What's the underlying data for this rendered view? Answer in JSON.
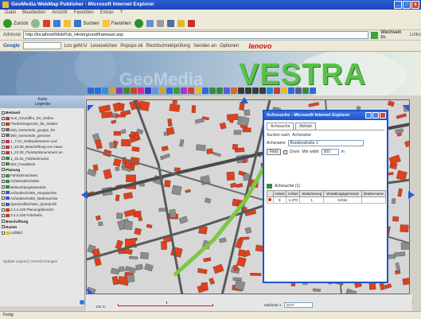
{
  "window": {
    "title": "GeoMedia WebMap Publisher - Microsoft Internet Explorer"
  },
  "menu": [
    "Datei",
    "Bearbeiten",
    "Ansicht",
    "Favoriten",
    "Extras",
    "?"
  ],
  "toolbar": {
    "back": "Zurück",
    "search": "Suchen",
    "favorites": "Favoriten"
  },
  "address": {
    "label": "Adresse",
    "url": "http://localhost/WebPub_Hintergrund/frameset.asp",
    "go": "Wechseln zu",
    "links": "Links"
  },
  "google": {
    "label": "Google",
    "items": [
      "Los geht's!",
      "Lesezeichen",
      "Popups ok",
      "Rechtschreibprüfung",
      "Senden an",
      "Optionen"
    ],
    "brand": "lenovo"
  },
  "banner": {
    "left": "GeoMedia",
    "right": "VESTRA"
  },
  "legend": {
    "header_line1": "Karte",
    "header_line2": "Legende",
    "groups": [
      {
        "label": "Bestand",
        "items": [
          "ALK_Grundflur_für_Online",
          "Flurstücksgrenze_für_Gebiet",
          "200_Gemeinde_gruppe_für",
          "300_Gemeinde_grenzen",
          "1_7:22_Gebäudenamen und",
          "1_10:30_Beschriftung von Haus",
          "1_21:30_Flurstücksnummern an",
          "1_22:31_Fahrbahnrand",
          "302_Fundstück"
        ]
      },
      {
        "label": "Planung",
        "items": [
          "Fahrbahnachsen",
          "Achsenabschnitte",
          "Beleuchtungsstandort",
          "Achsabschnitte_Hauptachse",
          "Achsabschnitte_Nebenachse",
          "Querprofilachsen_Querprofil",
          "3.2.4.100 Planungsbereich",
          "3.2.4.100 Fahrbahn"
        ]
      },
      {
        "label": "Beschriftung",
        "items": []
      },
      {
        "label": "Raster",
        "items": [
          "Luftbild"
        ]
      }
    ],
    "footer": "Update Legend | Overall Changes"
  },
  "popup": {
    "title": "Achssuche - Microsoft Internet Explorer",
    "tabs": [
      "Achssuche",
      "Achsnr"
    ],
    "search_for_label": "Suchen nach",
    "search_for_value": "Achsname",
    "axis_label": "Achsname",
    "axis_value": "Bundesstraße 1",
    "find_button": "Find",
    "zoom_label": "Zoom",
    "min_width_label": "Min width",
    "min_width_value": "500",
    "min_width_unit": "m",
    "results_title": "Achssuche (1)",
    "columns": [
      "Anlass",
      "Achsnr",
      "Stationierung",
      "Verwaltungsgemeinde",
      "Straßenname"
    ],
    "rows": [
      {
        "anlass": "8",
        "achsnr": "1,370",
        "station": "1",
        "verwaltung": "Achse",
        "name": ""
      }
    ]
  },
  "scale": {
    "label": "100 m",
    "mstab_label": "Maßstab 1:",
    "mstab_value": "4272"
  },
  "status": "Fertig",
  "colors": {
    "buildings": "#e0401c",
    "map_bg": "#d9d9d9",
    "road_highlight": "#7ec845",
    "title_blue": "#1d55c8"
  }
}
